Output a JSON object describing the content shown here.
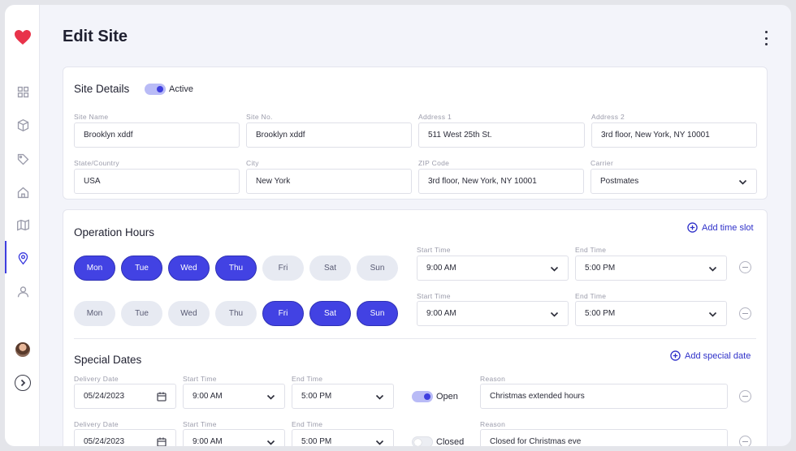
{
  "page": {
    "title": "Edit Site"
  },
  "sidebar": {
    "items": [
      {
        "name": "dashboard-icon"
      },
      {
        "name": "box-icon"
      },
      {
        "name": "tag-icon"
      },
      {
        "name": "home-icon"
      },
      {
        "name": "map-icon"
      },
      {
        "name": "location-pin-icon",
        "active": true
      },
      {
        "name": "user-icon"
      }
    ]
  },
  "site_details": {
    "title": "Site Details",
    "active_label": "Active",
    "active": true,
    "fields": {
      "site_name": {
        "label": "Site Name",
        "value": "Brooklyn xddf"
      },
      "site_no": {
        "label": "Site No.",
        "value": "Brooklyn xddf"
      },
      "address1": {
        "label": "Address 1",
        "value": "511 West 25th St."
      },
      "address2": {
        "label": "Address 2",
        "value": "3rd floor, New York, NY 10001"
      },
      "state": {
        "label": "State/Country",
        "value": "USA"
      },
      "city": {
        "label": "City",
        "value": "New York"
      },
      "zip": {
        "label": "ZIP Code",
        "value": "3rd floor, New York, NY 10001"
      },
      "carrier": {
        "label": "Carrier",
        "value": "Postmates"
      }
    }
  },
  "operation_hours": {
    "title": "Operation Hours",
    "add_label": "Add time slot",
    "start_label": "Start Time",
    "end_label": "End Time",
    "rows": [
      {
        "days": [
          {
            "label": "Mon",
            "on": true
          },
          {
            "label": "Tue",
            "on": true
          },
          {
            "label": "Wed",
            "on": true
          },
          {
            "label": "Thu",
            "on": true
          },
          {
            "label": "Fri",
            "on": false
          },
          {
            "label": "Sat",
            "on": false
          },
          {
            "label": "Sun",
            "on": false
          }
        ],
        "start": "9:00 AM",
        "end": "5:00 PM"
      },
      {
        "days": [
          {
            "label": "Mon",
            "on": false
          },
          {
            "label": "Tue",
            "on": false
          },
          {
            "label": "Wed",
            "on": false
          },
          {
            "label": "Thu",
            "on": false
          },
          {
            "label": "Fri",
            "on": true
          },
          {
            "label": "Sat",
            "on": true
          },
          {
            "label": "Sun",
            "on": true
          }
        ],
        "start": "9:00 AM",
        "end": "5:00 PM"
      }
    ]
  },
  "special_dates": {
    "title": "Special Dates",
    "add_label": "Add special date",
    "delivery_label": "Delivery Date",
    "start_label": "Start Time",
    "end_label": "End Time",
    "reason_label": "Reason",
    "rows": [
      {
        "date": "05/24/2023",
        "start": "9:00 AM",
        "end": "5:00 PM",
        "status": "Open",
        "open": true,
        "reason": "Christmas extended hours"
      },
      {
        "date": "05/24/2023",
        "start": "9:00 AM",
        "end": "5:00 PM",
        "status": "Closed",
        "open": false,
        "reason": "Closed for Christmas eve"
      }
    ]
  },
  "colors": {
    "accent": "#4242e3",
    "brand": "#e8334a",
    "background": "#f3f4fa"
  }
}
